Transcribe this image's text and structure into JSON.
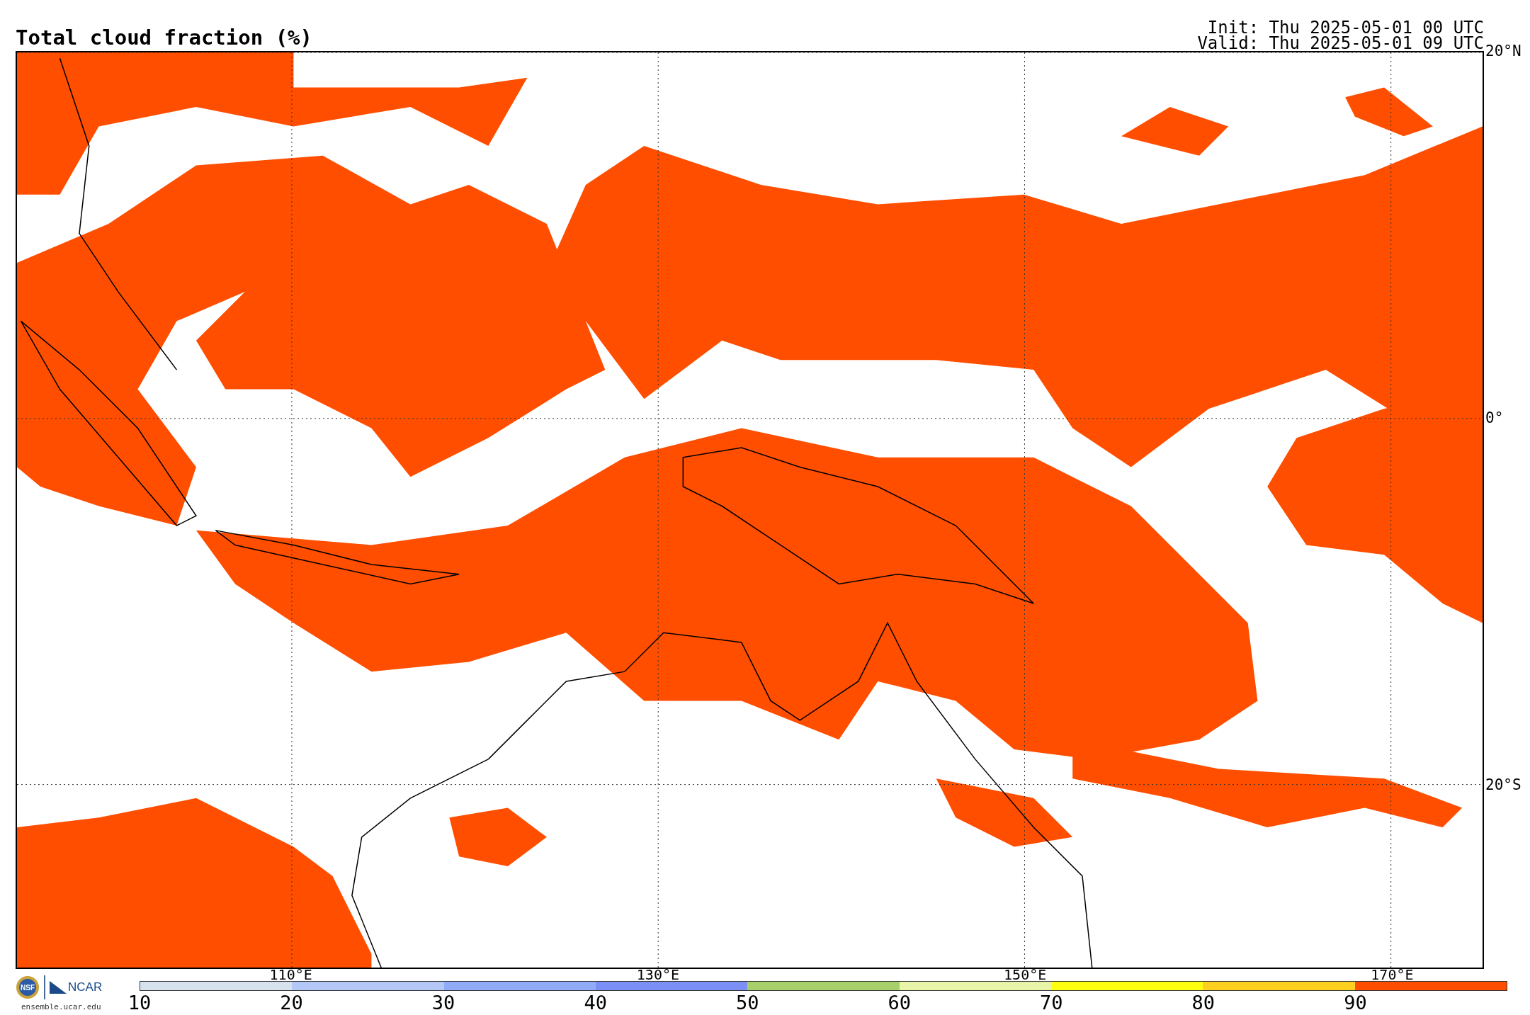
{
  "title": "Total cloud fraction (%)",
  "run_info": {
    "init": "Init: Thu 2025-05-01 00 UTC",
    "valid": "Valid: Thu 2025-05-01 09 UTC"
  },
  "map": {
    "lon_labels": [
      "110°E",
      "130°E",
      "150°E",
      "170°E"
    ],
    "lat_labels": [
      "20°N",
      "0°",
      "20°S"
    ]
  },
  "colorbar": {
    "segments": [
      {
        "from": "10",
        "color": "#d6e2ed"
      },
      {
        "from": "20",
        "color": "#b4c8f8"
      },
      {
        "from": "30",
        "color": "#90acf8"
      },
      {
        "from": "40",
        "color": "#7b8ff5"
      },
      {
        "from": "50",
        "color": "#a8d06a"
      },
      {
        "from": "60",
        "color": "#e8f4a8"
      },
      {
        "from": "70",
        "color": "#ffff10"
      },
      {
        "from": "80",
        "color": "#ffd020"
      },
      {
        "from": "90",
        "color": "#ff4e00"
      }
    ]
  },
  "logos": {
    "nsf": "NSF",
    "ncar": "NCAR",
    "site": "ensemble.ucar.edu"
  }
}
